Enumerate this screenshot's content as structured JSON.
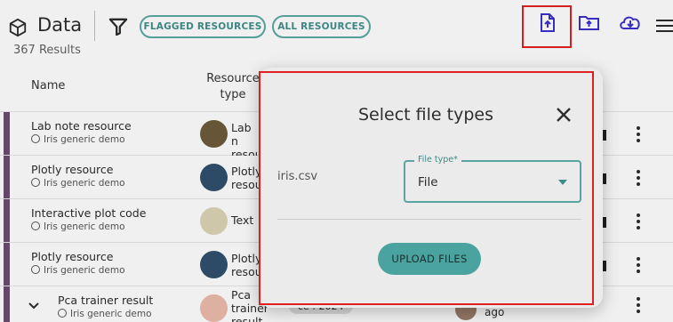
{
  "header": {
    "title": "Data",
    "results": "367 Results",
    "chips": [
      "FLAGGED RESOURCES",
      "ALL RESOURCES"
    ],
    "icons": [
      "cube-icon",
      "filter-icon",
      "file-upload-icon",
      "folder-upload-icon",
      "cloud-download-icon",
      "menu-icon"
    ],
    "accent_color": "#5aa5a1",
    "action_color": "#3b2fc9"
  },
  "table": {
    "columns": [
      "Name",
      "Resource type"
    ],
    "rows": [
      {
        "name": "Lab note resource",
        "sub": "Iris generic demo",
        "type": "Lab n resou",
        "icon_color": "#6b5a3a"
      },
      {
        "name": "Plotly resource",
        "sub": "Iris generic demo",
        "type": "Plotly resou",
        "icon_color": "#2f4f6b"
      },
      {
        "name": "Interactive plot code",
        "sub": "Iris generic demo",
        "type": "Text",
        "icon_color": "#d8d0b0"
      },
      {
        "name": "Plotly resource",
        "sub": "Iris generic demo",
        "type": "Plotly resou",
        "icon_color": "#2f4f6b"
      },
      {
        "name": "Pca trainer result",
        "sub": "Iris generic demo",
        "type": "Pca trainer result",
        "icon_color": "#e8b8a8"
      }
    ],
    "peek": {
      "date_chip": "ce : 2024",
      "ago": "ago"
    }
  },
  "dialog": {
    "title": "Select file types",
    "file_name": "iris.csv",
    "select_label": "File type*",
    "select_value": "File",
    "upload_label": "UPLOAD FILES"
  }
}
